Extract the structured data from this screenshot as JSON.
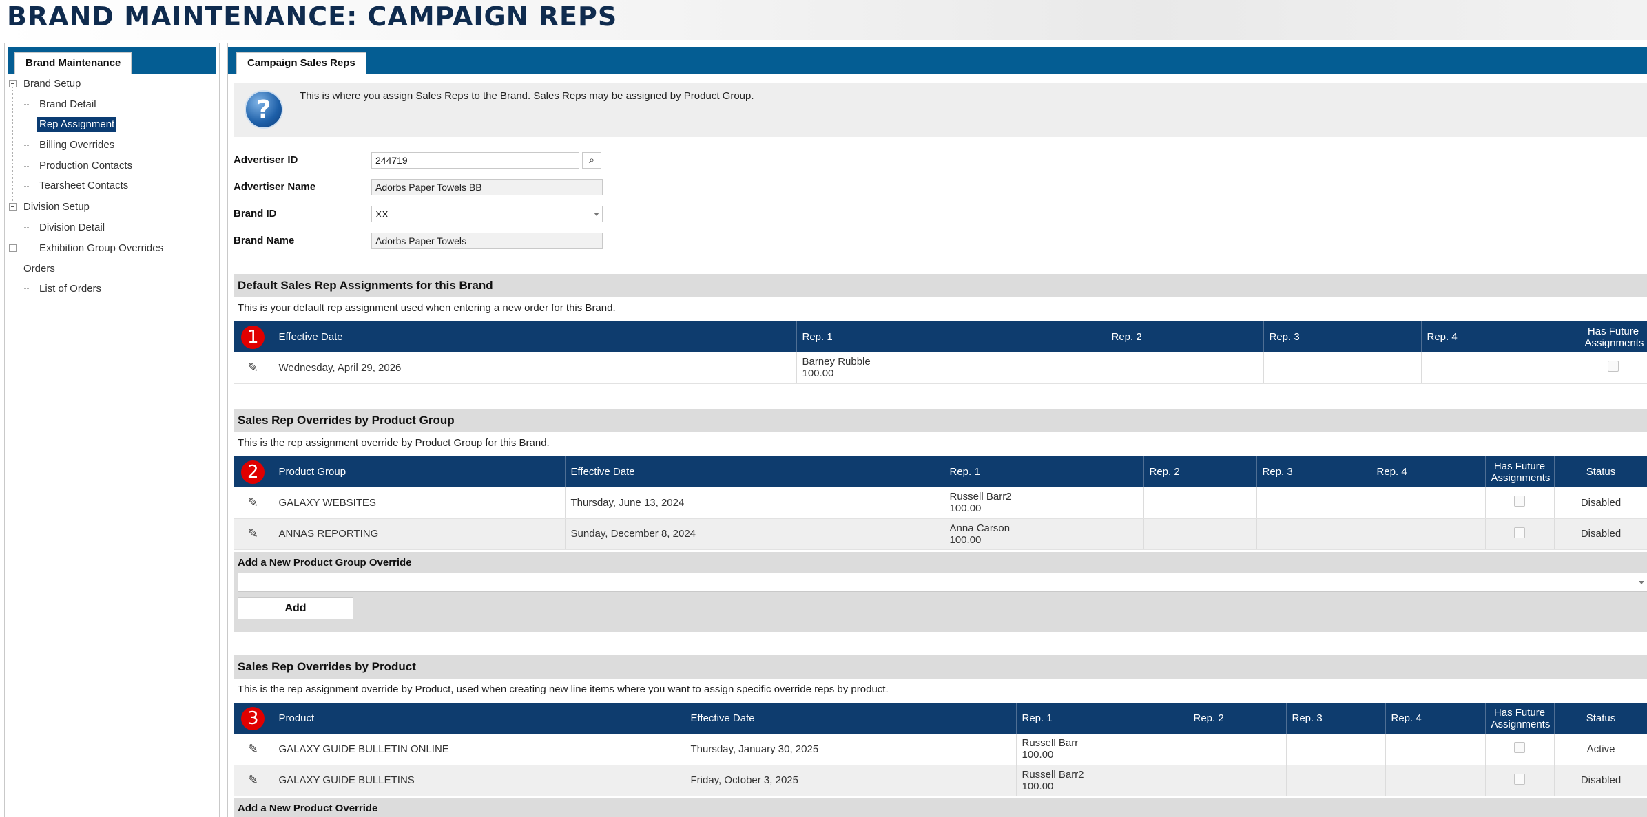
{
  "page": {
    "title": "BRAND MAINTENANCE: CAMPAIGN REPS"
  },
  "left_panel": {
    "tab_label": "Brand Maintenance",
    "tree": [
      {
        "label": "Brand Setup",
        "level": 0
      },
      {
        "label": "Brand Detail",
        "level": 1
      },
      {
        "label": "Rep Assignment",
        "level": 1,
        "selected": true
      },
      {
        "label": "Billing Overrides",
        "level": 1
      },
      {
        "label": "Production Contacts",
        "level": 1
      },
      {
        "label": "Tearsheet Contacts",
        "level": 1
      },
      {
        "label": "Division Setup",
        "level": 0
      },
      {
        "label": "Division Detail",
        "level": 1
      },
      {
        "label": "Exhibition Group Overrides",
        "level": 1
      },
      {
        "label": "Orders",
        "level": 0
      },
      {
        "label": "List of Orders",
        "level": 1
      }
    ]
  },
  "main": {
    "tab_label": "Campaign Sales Reps",
    "info_icon": "help-question-icon",
    "info_text": "This is where you assign Sales Reps to the Brand. Sales Reps may be assigned by Product Group.",
    "form": {
      "advertiser_id_label": "Advertiser ID",
      "advertiser_id_value": "244719",
      "advertiser_name_label": "Advertiser Name",
      "advertiser_name_value": "Adorbs Paper Towels BB",
      "brand_id_label": "Brand ID",
      "brand_id_value": "XX",
      "brand_name_label": "Brand Name",
      "brand_name_value": "Adorbs Paper Towels"
    },
    "default_section": {
      "title": "Default Sales Rep Assignments for this Brand",
      "description": "This is your default rep assignment used when entering a new order for this Brand.",
      "badge": "1",
      "headers": [
        "Effective Date",
        "Rep. 1",
        "Rep. 2",
        "Rep. 3",
        "Rep. 4",
        "Has Future Assignments"
      ],
      "rows": [
        {
          "effective_date": "Wednesday, April 29, 2026",
          "rep1_name": "Barney Rubble",
          "rep1_pct": "100.00",
          "rep2": "",
          "rep3": "",
          "rep4": "",
          "has_future": false
        }
      ]
    },
    "product_group_section": {
      "title": "Sales Rep Overrides by Product Group",
      "description": "This is the rep assignment override by Product Group for this Brand.",
      "badge": "2",
      "headers": [
        "Product Group",
        "Effective Date",
        "Rep. 1",
        "Rep. 2",
        "Rep. 3",
        "Rep. 4",
        "Has Future Assignments",
        "Status"
      ],
      "rows": [
        {
          "group": "GALAXY WEBSITES",
          "effective_date": "Thursday, June 13, 2024",
          "rep1_name": "Russell Barr2",
          "rep1_pct": "100.00",
          "has_future": false,
          "status": "Disabled"
        },
        {
          "group": "ANNAS REPORTING",
          "effective_date": "Sunday, December 8, 2024",
          "rep1_name": "Anna Carson",
          "rep1_pct": "100.00",
          "has_future": false,
          "status": "Disabled"
        }
      ],
      "add_label": "Add a New Product Group Override",
      "add_button": "Add"
    },
    "product_section": {
      "title": "Sales Rep Overrides by Product",
      "description": "This is the rep assignment override by Product, used when creating new line items where you want to assign specific override reps by product.",
      "badge": "3",
      "headers": [
        "Product",
        "Effective Date",
        "Rep. 1",
        "Rep. 2",
        "Rep. 3",
        "Rep. 4",
        "Has Future Assignments",
        "Status"
      ],
      "rows": [
        {
          "product": "GALAXY GUIDE BULLETIN ONLINE",
          "effective_date": "Thursday, January 30, 2025",
          "rep1_name": "Russell Barr",
          "rep1_pct": "100.00",
          "has_future": false,
          "status": "Active"
        },
        {
          "product": "GALAXY GUIDE BULLETINS",
          "effective_date": "Friday, October 3, 2025",
          "rep1_name": "Russell Barr2",
          "rep1_pct": "100.00",
          "has_future": false,
          "status": "Disabled"
        }
      ],
      "add_label": "Add a New Product Override"
    }
  }
}
